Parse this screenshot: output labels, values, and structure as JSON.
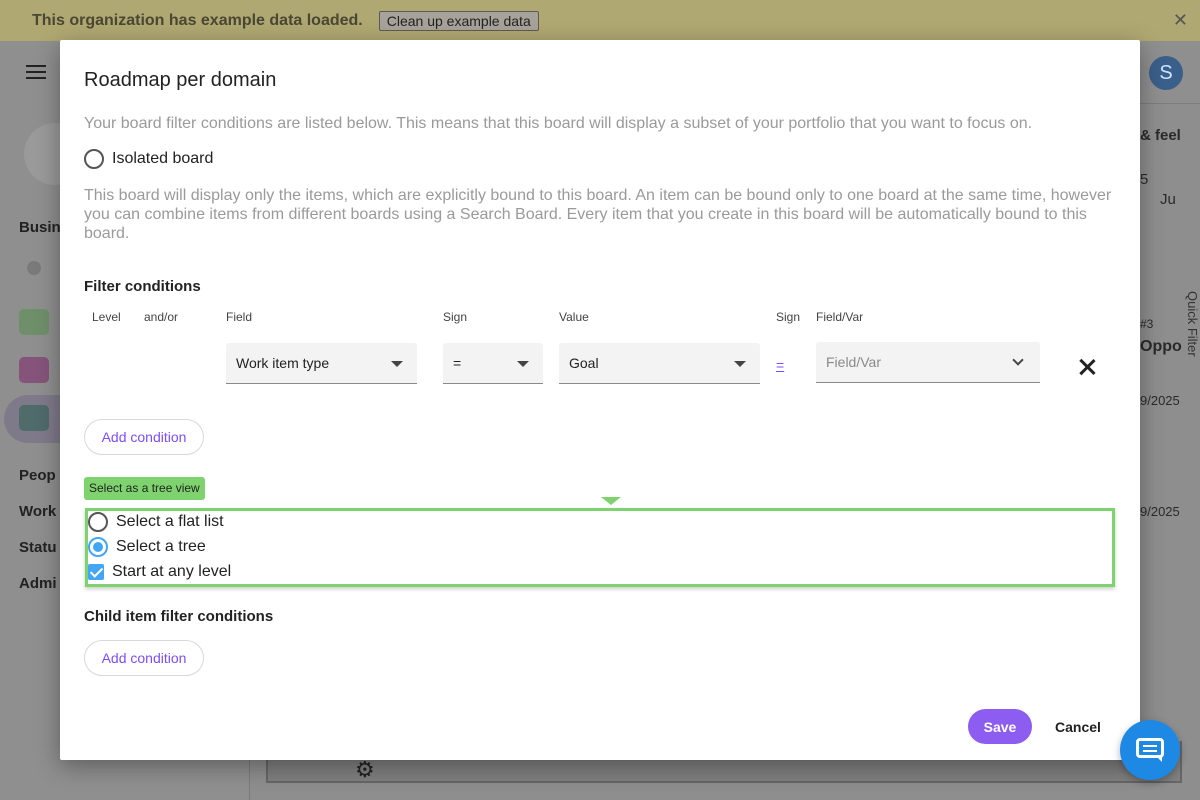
{
  "banner": {
    "text": "This organization has example data loaded.",
    "cleanup_label": "Clean up example data",
    "close_glyph": "✕"
  },
  "background": {
    "avatar_letter": "S",
    "sidebar_headings": [
      "Busin",
      "Peop",
      "Work",
      "Statu",
      "Admi"
    ],
    "right_texts": [
      "& feel",
      "5",
      "Ju",
      "#3",
      "Oppo",
      "9/2025",
      "9/2025"
    ],
    "quick_filter_label": "Quick Filter",
    "gear_glyph": "⚙"
  },
  "modal": {
    "title": "Roadmap per domain",
    "description": "Your board filter conditions are listed below. This means that this board will display a subset of your portfolio that you want to focus on.",
    "isolated_label": "Isolated board",
    "isolated_description": "This board will display only the items, which are explicitly bound to this board. An item can be bound only to one board at the same time, however you can combine items from different boards using a Search Board. Every item that you create in this board will be automatically bound to this board.",
    "filter_title": "Filter conditions",
    "columns": {
      "level": "Level",
      "andor": "and/or",
      "field": "Field",
      "sign": "Sign",
      "value": "Value",
      "sign2": "Sign",
      "fieldvar": "Field/Var"
    },
    "condition": {
      "field": "Work item type",
      "sign": "=",
      "value": "Goal",
      "sign_link": "=",
      "fieldvar_placeholder": "Field/Var"
    },
    "add_condition_label": "Add condition",
    "tooltip": "Select as a tree view",
    "view_options": {
      "flat": "Select a flat list",
      "tree": "Select a tree",
      "any_level": "Start at any level"
    },
    "child_title": "Child item filter conditions",
    "child_add_label": "Add condition",
    "save_label": "Save",
    "cancel_label": "Cancel"
  }
}
